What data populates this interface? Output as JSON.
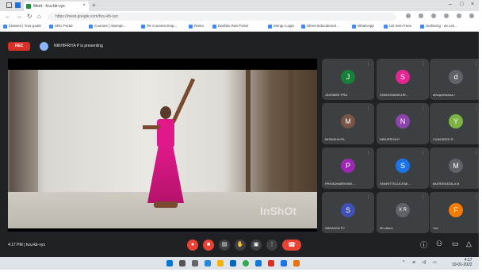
{
  "browser": {
    "tab_title": "Meet - hcu-kb-vyx",
    "new_tab": "+",
    "url": "https://meet.google.com/hcu-kb-vyx",
    "bookmarks": [
      "Classes | Your goals",
      "SRU Portal",
      "Courses | Attempt...",
      "Tsr Courses Emp...",
      "Ramo",
      "Dashbo Rati Portal",
      "Mongo Login",
      "Shree Educational ...",
      "WhatsApp",
      "US Sem Fees",
      "Surfacing - as Lim..."
    ]
  },
  "meet": {
    "rec_label": "REC",
    "presenter_text": "NIKHIFRIYA P is presenting",
    "video_watermark": "InShOt",
    "participants": [
      {
        "initial": "J",
        "name": "JASSMEE PRA",
        "color": "#188038"
      },
      {
        "initial": "S",
        "name": "SHAROMANIKUR...",
        "color": "#e52592"
      },
      {
        "initial": "d",
        "name": "devapreeshna r",
        "color": "#5f6368"
      },
      {
        "initial": "M",
        "name": "MONISHA PA",
        "color": "#795548"
      },
      {
        "initial": "N",
        "name": "NIRUPRIYA P",
        "color": "#8e44ad"
      },
      {
        "initial": "Y",
        "name": "YUVASREE R",
        "color": "#7cb342"
      },
      {
        "initial": "P",
        "name": "PRIYADHARSHINI ...",
        "color": "#9c27b0"
      },
      {
        "initial": "S",
        "name": "SHARITTELIJCFAE...",
        "color": "#1a73e8"
      },
      {
        "initial": "M",
        "name": "MUREEKATALA M",
        "color": "#5f6368"
      },
      {
        "initial": "S",
        "name": "SARANYA PY",
        "color": "#3f51b5"
      },
      {
        "initial": "X R",
        "name": "55 others",
        "color": "#5f6368"
      },
      {
        "initial": "F",
        "name": "You",
        "color": "#f57c00"
      }
    ],
    "clock": "4:17 PM",
    "meeting_code": "hcu-kb-vyx"
  },
  "taskbar": {
    "time": "4:17",
    "date": "10-01-2022"
  }
}
